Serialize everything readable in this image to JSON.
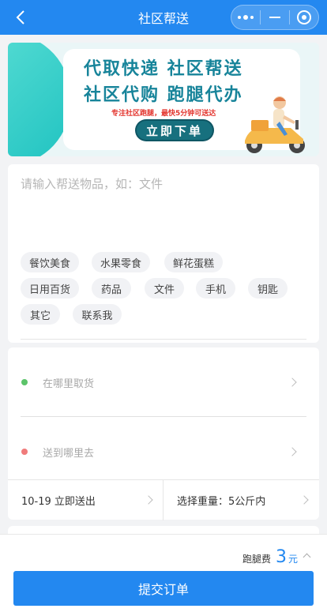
{
  "header": {
    "title": "社区帮送",
    "icons": [
      "back-icon",
      "more-dots-icon",
      "minimize-icon",
      "close-target-icon"
    ]
  },
  "banner": {
    "line1": "代取快递 社区帮送",
    "line2": "社区代购 跑腿代办",
    "subtitle": "专注社区跑腿，最快5分钟可送达",
    "cta": "立即下单"
  },
  "item": {
    "placeholder": "请输入帮送物品，如：文件",
    "value": "",
    "tags": [
      "餐饮美食",
      "水果零食",
      "鲜花蛋糕",
      "日用百货",
      "药品",
      "文件",
      "手机",
      "钥匙",
      "其它",
      "联系我"
    ]
  },
  "address": {
    "pickup": "在哪里取货",
    "pickup_color": "#5cc46a",
    "dropoff": "送到哪里去",
    "dropoff_color": "#f07b7b"
  },
  "options": {
    "time": "10-19 立即送出",
    "weight": "选择重量：5公斤内"
  },
  "footer": {
    "fee_label": "跑腿费",
    "fee_amount": "3",
    "fee_unit": "元",
    "submit": "提交订单"
  },
  "colors": {
    "primary": "#2388f0",
    "banner_teal": "#17849a"
  }
}
